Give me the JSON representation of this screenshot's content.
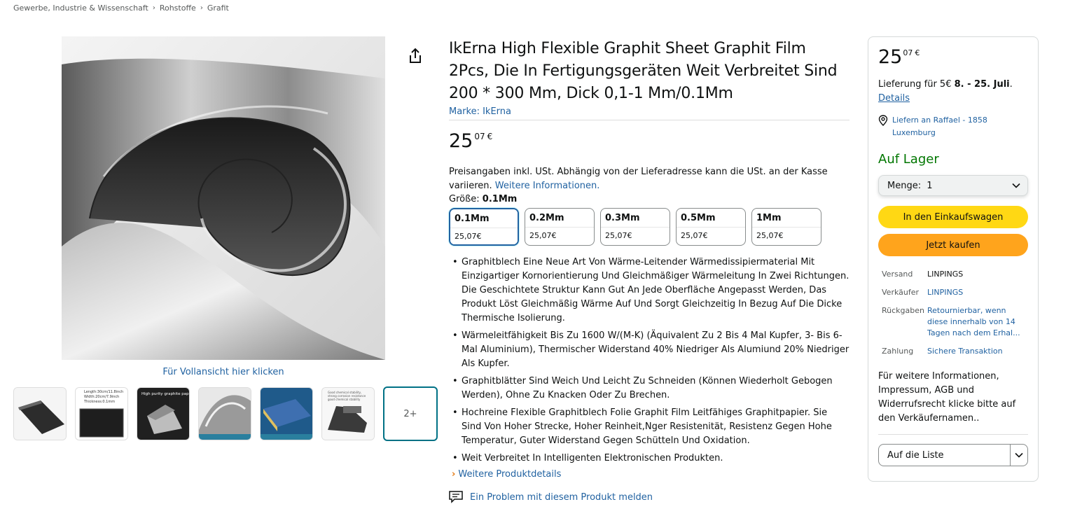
{
  "breadcrumb": [
    "Gewerbe, Industrie & Wissenschaft",
    "Rohstoffe",
    "Grafit"
  ],
  "gallery": {
    "fullview_label": "Für Vollansicht hier klicken",
    "more_label": "2+",
    "thumbs": [
      {
        "icon": "graphite-sheet-thumb"
      },
      {
        "icon": "graphite-dimensions-thumb",
        "text": "Length:30cm/11.8inch Width:20cm/7.9inch Thickness:0.1mm"
      },
      {
        "icon": "graphite-purity-thumb",
        "text": "High purity graphite paper"
      },
      {
        "icon": "graphite-roll-thumb"
      },
      {
        "icon": "graphite-stack-thumb"
      },
      {
        "icon": "graphite-features-thumb",
        "text": "Good chemical stability, strong corrosion resistance, good chemical stability"
      }
    ]
  },
  "product": {
    "title": "IkErna High Flexible Graphit Sheet Graphit Film 2Pcs, Die In Fertigungsgeräten Weit Verbreitet Sind 200 * 300 Mm, Dick 0,1-1 Mm/0.1Mm",
    "brand": "Marke: IkErna",
    "price_whole": "25",
    "price_fraction": "07",
    "currency": "€",
    "tax_note": "Preisangaben inkl. USt. Abhängig von der Lieferadresse kann die USt. an der Kasse variieren.",
    "tax_link": "Weitere Informationen.",
    "size_label": "Größe:",
    "size_selected": "0.1Mm",
    "sizes": [
      {
        "name": "0.1Mm",
        "price": "25,07€"
      },
      {
        "name": "0.2Mm",
        "price": "25,07€"
      },
      {
        "name": "0.3Mm",
        "price": "25,07€"
      },
      {
        "name": "0.5Mm",
        "price": "25,07€"
      },
      {
        "name": "1Mm",
        "price": "25,07€"
      }
    ],
    "bullets": [
      "Graphitblech Eine Neue Art Von Wärme-Leitender Wärmedissipiermaterial Mit Einzigartiger Kornorientierung Und Gleichmäßiger Wärmeleitung In Zwei Richtungen. Die Geschichtete Struktur Kann Gut An Jede Oberfläche Angepasst Werden, Das Produkt Löst Gleichmäßig Wärme Auf Und Sorgt Gleichzeitig In Bezug Auf Die Dicke Thermische Isolierung.",
      "Wärmeleitfähigkeit Bis Zu 1600 W/(M-K) (Äquivalent Zu 2 Bis 4 Mal Kupfer, 3- Bis 6-Mal Aluminium), Thermischer Widerstand 40% Niedriger Als Alumiund 20% Niedriger Als Kupfer.",
      "Graphitblätter Sind Weich Und Leicht Zu Schneiden (Können Wiederholt Gebogen Werden), Ohne Zu Knacken Oder Zu Brechen.",
      "Hochreine Flexible Graphitblech Folie Graphit Film Leitfähiges Graphitpapier. Sie Sind Von Hoher Strecke, Hoher Reinheit,Nger Resistenität, Resistenz Gegen Hohe Temperatur, Guter Widerstand Gegen Schütteln Und Oxidation.",
      "Weit Verbreitet In Intelligenten Elektronischen Produkten."
    ],
    "more_details": "Weitere Produktdetails",
    "report": "Ein Problem mit diesem Produkt melden"
  },
  "buybox": {
    "price_whole": "25",
    "price_fraction": "07",
    "currency": "€",
    "delivery_prefix": "Lieferung für 5€",
    "delivery_dates": "8. - 25. Juli",
    "delivery_suffix": ".",
    "details_link": "Details",
    "location": "Liefern an Raffael - 1858 Luxemburg",
    "stock": "Auf Lager",
    "qty_label": "Menge:",
    "qty_value": "1",
    "cart_button": "In den Einkaufswagen",
    "buy_button": "Jetzt kaufen",
    "info": [
      {
        "key": "Versand",
        "value": "LINPINGS",
        "link": false
      },
      {
        "key": "Verkäufer",
        "value": "LINPINGS",
        "link": true
      },
      {
        "key": "Rückgaben",
        "value": "Retournierbar, wenn diese innerhalb von 14 Tagen nach dem Erhal...",
        "link": true
      },
      {
        "key": "Zahlung",
        "value": "Sichere Transaktion",
        "link": true
      }
    ],
    "seller_note": "Für weitere Informationen, Impressum, AGB und Widerrufsrecht klicke bitte auf den Verkäufernamen..",
    "list_button": "Auf die Liste"
  },
  "colors": {
    "link": "#2162a1",
    "stock_green": "#007600",
    "cart_yellow": "#ffd814",
    "buy_orange": "#ffa41c",
    "selected_border": "#2162a1"
  }
}
